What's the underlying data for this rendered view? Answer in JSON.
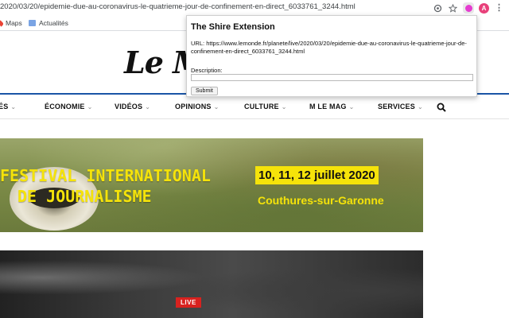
{
  "browser": {
    "url": "2020/03/20/epidemie-due-au-coronavirus-le-quatrieme-jour-de-confinement-en-direct_6033761_3244.html",
    "avatar_letter": "A",
    "bookmarks": [
      {
        "label": "Maps",
        "icon": "maps-pin-icon"
      },
      {
        "label": "Actualités",
        "icon": "news-icon"
      }
    ],
    "icons": [
      "lens-icon",
      "star-icon",
      "extension-icon",
      "profile-avatar",
      "menu-dots-icon"
    ]
  },
  "site": {
    "logo_text": "Le M",
    "nav": [
      {
        "label": "ÉS",
        "chevron": true
      },
      {
        "label": "ÉCONOMIE",
        "chevron": true
      },
      {
        "label": "VIDÉOS",
        "chevron": true
      },
      {
        "label": "OPINIONS",
        "chevron": true
      },
      {
        "label": "CULTURE",
        "chevron": true
      },
      {
        "label": "M LE MAG",
        "chevron": true
      },
      {
        "label": "SERVICES",
        "chevron": true
      }
    ],
    "chevron_glyph": "⌄",
    "accent_color": "#1a55a6"
  },
  "banner": {
    "line1": "FESTIVAL INTERNATIONAL",
    "line2": "DE JOURNALISME",
    "dates": "10, 11, 12 juillet 2020",
    "place": "Couthures-sur-Garonne",
    "text_color": "#f5e30a"
  },
  "video": {
    "live_label": "LIVE",
    "live_color": "#d8221f"
  },
  "popup": {
    "title": "The Shire Extension",
    "url_label": "URL:",
    "url_value": "https://www.lemonde.fr/planete/live/2020/03/20/epidemie-due-au-coronavirus-le-quatrieme-jour-de-confinement-en-direct_6033761_3244.html",
    "description_label": "Description:",
    "description_value": "",
    "submit_label": "Submit"
  }
}
